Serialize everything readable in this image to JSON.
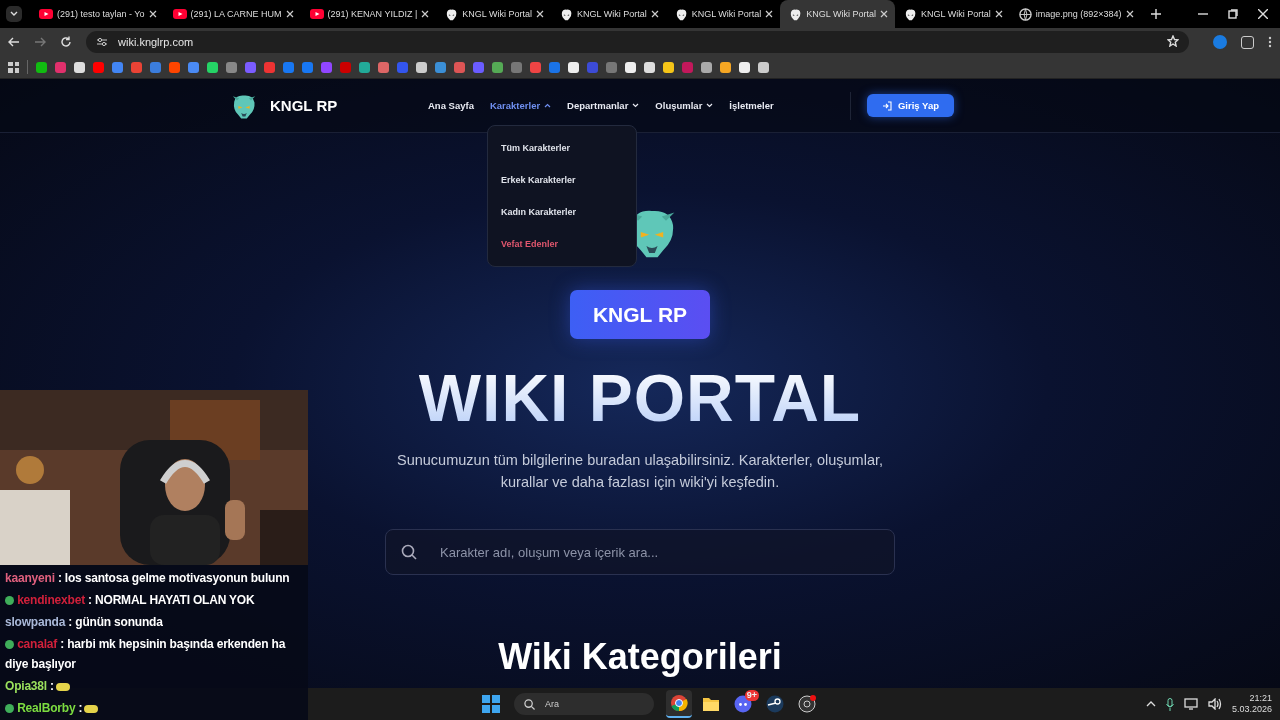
{
  "browser": {
    "tabs": [
      {
        "title": "(291) testo taylan - Yo",
        "kind": "video",
        "selected": false
      },
      {
        "title": "(291) LA CARNE HUM",
        "kind": "video",
        "selected": false
      },
      {
        "title": "(291) KENAN YILDIZ |",
        "kind": "video",
        "selected": false
      },
      {
        "title": "KNGL Wiki Portal",
        "kind": "site",
        "selected": false
      },
      {
        "title": "KNGL Wiki Portal",
        "kind": "site",
        "selected": false
      },
      {
        "title": "KNGL Wiki Portal",
        "kind": "site",
        "selected": false
      },
      {
        "title": "KNGL Wiki Portal",
        "kind": "site",
        "selected": true
      },
      {
        "title": "KNGL Wiki Portal",
        "kind": "site",
        "selected": false
      },
      {
        "title": "image.png (892×384)",
        "kind": "web",
        "selected": false
      }
    ],
    "address": "wiki.knglrp.com"
  },
  "site": {
    "logo": "KNGL RP",
    "nav": [
      {
        "label": "Ana Sayfa",
        "has_menu": false,
        "selected": false
      },
      {
        "label": "Karakterler",
        "has_menu": true,
        "selected": true
      },
      {
        "label": "Departmanlar",
        "has_menu": true,
        "selected": false
      },
      {
        "label": "Oluşumlar",
        "has_menu": true,
        "selected": false
      },
      {
        "label": "İşletmeler",
        "has_menu": false,
        "selected": false
      }
    ],
    "dropdown": [
      {
        "label": "Tüm Karakterler",
        "kind": "normal"
      },
      {
        "label": "Erkek Karakterler",
        "kind": "normal"
      },
      {
        "label": "Kadın Karakterler",
        "kind": "normal"
      },
      {
        "label": "Vefat Edenler",
        "kind": "danger"
      }
    ],
    "login": "Giriş Yap",
    "badge": "KNGL RP",
    "title": "WIKI PORTAL",
    "subtitle": "Sunucumuzun tüm bilgilerine buradan ulaşabilirsiniz. Karakterler, oluşumlar, kurallar ve daha fazlası için wiki'yi keşfedin.",
    "search": {
      "placeholder": "Karakter adı, oluşum veya içerik ara..."
    },
    "section_title": "Wiki Kategorileri"
  },
  "stream": {
    "chat": [
      {
        "user": "kaanyeni",
        "color": "#e0607e",
        "badge": false,
        "emote": false,
        "text": ": los santosa gelme motivasyonun bulunn"
      },
      {
        "user": "kendinexbet",
        "color": "#d0203a",
        "badge": true,
        "emote": false,
        "text": ": NORMAL HAYATI OLAN YOK"
      },
      {
        "user": "slowpanda",
        "color": "#a9b8d8",
        "badge": false,
        "emote": false,
        "text": ": günün sonunda"
      },
      {
        "user": "canalaf",
        "color": "#d0203a",
        "badge": true,
        "emote": false,
        "text": ": harbi mk hepsinin başında erkenden ha diye başlıyor"
      },
      {
        "user": "Opia38l",
        "color": "#9be15d",
        "badge": false,
        "emote": true,
        "text": ":"
      },
      {
        "user": "RealBorby",
        "color": "#7cdc40",
        "badge": true,
        "emote": true,
        "text": ":"
      }
    ]
  },
  "taskbar": {
    "search": "Ara",
    "time": "21:21",
    "date": "5.03.2026",
    "apps": [
      {
        "kind": "chrome",
        "selected": true
      },
      {
        "kind": "folder",
        "selected": false
      },
      {
        "kind": "discord",
        "selected": false
      },
      {
        "kind": "steam",
        "selected": false
      },
      {
        "kind": "obs",
        "selected": false
      }
    ],
    "discord_badge": "9+"
  }
}
